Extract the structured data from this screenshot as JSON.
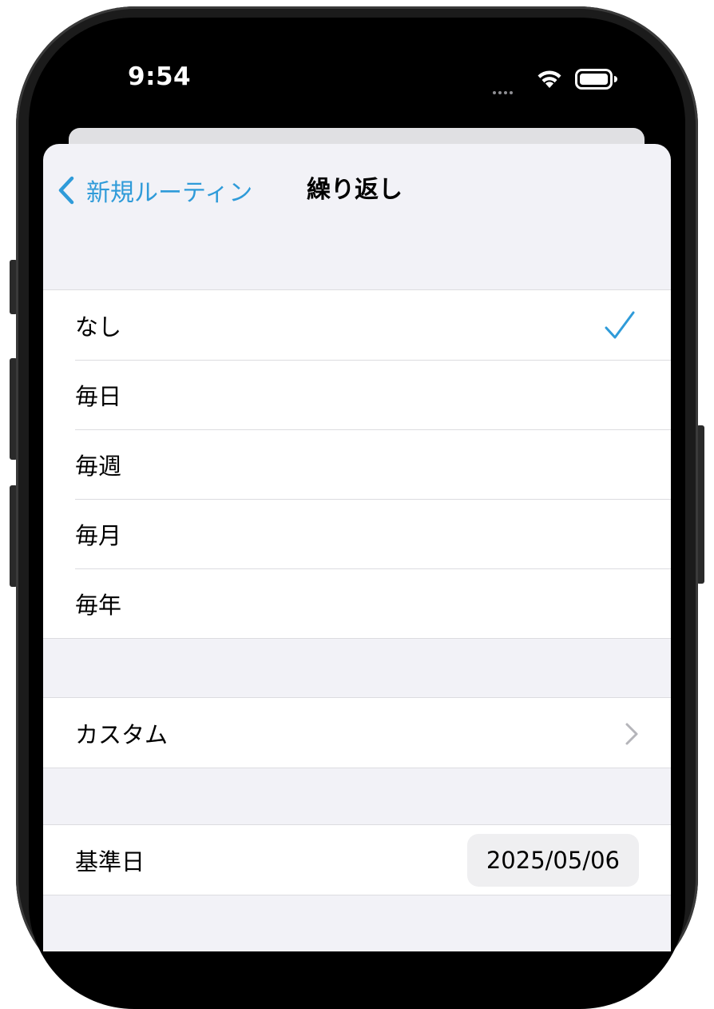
{
  "status_bar": {
    "time": "9:54"
  },
  "nav": {
    "back_label": "新規ルーティン",
    "title": "繰り返し"
  },
  "repeat_options": [
    {
      "label": "なし",
      "selected": true
    },
    {
      "label": "毎日",
      "selected": false
    },
    {
      "label": "毎週",
      "selected": false
    },
    {
      "label": "毎月",
      "selected": false
    },
    {
      "label": "毎年",
      "selected": false
    }
  ],
  "custom": {
    "label": "カスタム"
  },
  "base_date": {
    "label": "基準日",
    "value": "2025/05/06"
  },
  "colors": {
    "accent": "#2f9bd9",
    "grouped_background": "#f2f2f7",
    "cell": "#ffffff"
  },
  "icons": {
    "back": "chevron-left-icon",
    "check": "checkmark-icon",
    "disclosure": "chevron-right-icon"
  }
}
